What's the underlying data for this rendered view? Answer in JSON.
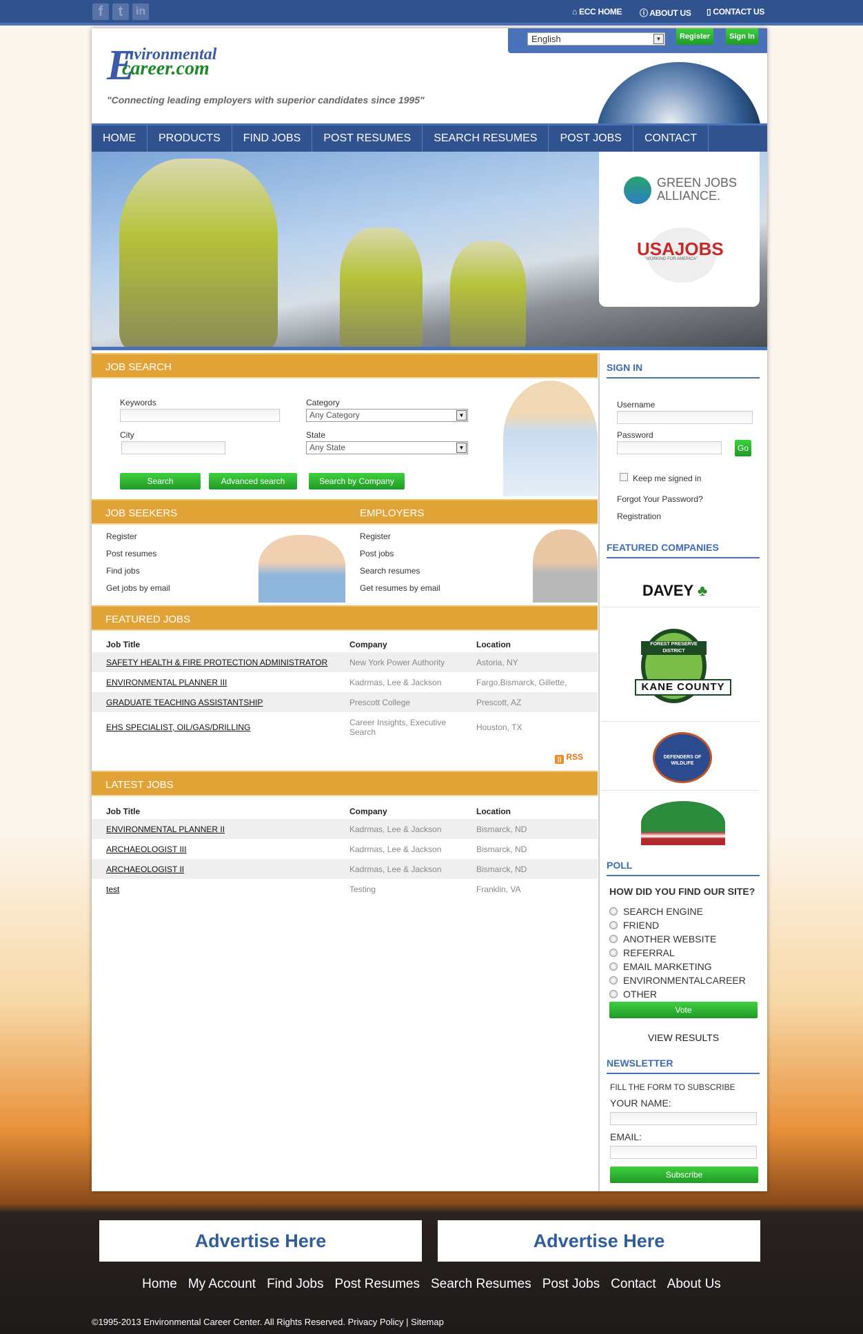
{
  "topbar": {
    "social": [
      "f",
      "t",
      "in"
    ],
    "links": [
      "ECC HOME",
      "ABOUT US",
      "CONTACT US"
    ]
  },
  "header": {
    "language": "English",
    "register": "Register",
    "signin": "Sign In",
    "logo_line1": "nvironmental",
    "logo_line2": "career.com",
    "logo_letter": "E",
    "tagline": "\"Connecting leading employers with superior candidates since 1995\""
  },
  "nav": [
    "HOME",
    "PRODUCTS",
    "FIND JOBS",
    "POST RESUMES",
    "SEARCH RESUMES",
    "POST JOBS",
    "CONTACT"
  ],
  "partners": {
    "gja1": "GREEN JOBS",
    "gja2": "ALLIANCE.",
    "usa": "USAJOBS",
    "usa_sub": "\"WORKING FOR AMERICA\""
  },
  "job_search": {
    "title": "JOB SEARCH",
    "keywords": "Keywords",
    "category": "Category",
    "category_value": "Any Category",
    "city": "City",
    "state": "State",
    "state_value": "Any State",
    "search": "Search",
    "advanced": "Advanced search",
    "by_company": "Search by Company"
  },
  "seekers": {
    "title": "JOB SEEKERS",
    "links": [
      "Register",
      "Post resumes",
      "Find jobs",
      "Get jobs by email"
    ]
  },
  "employers": {
    "title": "EMPLOYERS",
    "links": [
      "Register",
      "Post jobs",
      "Search resumes",
      "Get resumes by email"
    ]
  },
  "featured_jobs": {
    "title": "FEATURED JOBS",
    "headers": [
      "Job Title",
      "Company",
      "Location"
    ],
    "rows": [
      [
        "SAFETY HEALTH & FIRE PROTECTION ADMINISTRATOR",
        "New York Power Authority",
        "Astoria, NY"
      ],
      [
        "ENVIRONMENTAL PLANNER III",
        "Kadrmas, Lee & Jackson",
        "Fargo,Bismarck, Gillette,"
      ],
      [
        "GRADUATE TEACHING ASSISTANTSHIP",
        "Prescott College",
        "Prescott, AZ"
      ],
      [
        "EHS SPECIALIST, OIL/GAS/DRILLING",
        "Career Insights, Executive Search",
        "Houston, TX"
      ]
    ],
    "rss": "RSS"
  },
  "latest_jobs": {
    "title": "LATEST JOBS",
    "headers": [
      "Job Title",
      "Company",
      "Location"
    ],
    "rows": [
      [
        "ENVIRONMENTAL PLANNER II",
        "Kadrmas, Lee & Jackson",
        "Bismarck, ND"
      ],
      [
        "ARCHAEOLOGIST III",
        "Kadrmas, Lee & Jackson",
        "Bismarck, ND"
      ],
      [
        "ARCHAEOLOGIST II",
        "Kadrmas, Lee & Jackson",
        "Bismarck, ND"
      ],
      [
        "test",
        "Testing",
        "Franklin, VA"
      ]
    ]
  },
  "signin": {
    "title": "SIGN IN",
    "username": "Username",
    "password": "Password",
    "go": "Go",
    "keep": "Keep me signed in",
    "forgot": "Forgot Your Password?",
    "registration": "Registration"
  },
  "featured_companies": {
    "title": "FEATURED COMPANIES",
    "davey": "DAVEY",
    "kane1": "FOREST PRESERVE DISTRICT",
    "kane2": "KANE COUNTY",
    "defenders": "DEFENDERS OF WILDLIFE"
  },
  "poll": {
    "title": "POLL",
    "question": "HOW DID YOU FIND OUR SITE?",
    "options": [
      "SEARCH ENGINE",
      "FRIEND",
      "ANOTHER WEBSITE",
      "REFERRAL",
      "EMAIL MARKETING",
      "ENVIRONMENTALCAREER",
      "OTHER"
    ],
    "vote": "Vote",
    "results": "VIEW RESULTS"
  },
  "newsletter": {
    "title": "NEWSLETTER",
    "intro": "FILL THE FORM TO SUBSCRIBE",
    "name": "YOUR NAME:",
    "email": "EMAIL:",
    "subscribe": "Subscribe"
  },
  "footer": {
    "ads": [
      "Advertise Here",
      "Advertise Here"
    ],
    "links": [
      "Home",
      "My Account",
      "Find Jobs",
      "Post Resumes",
      "Search Resumes",
      "Post Jobs",
      "Contact",
      "About Us"
    ],
    "copyright": "©1995-2013 Environmental Career Center. All Rights Reserved.",
    "privacy": "Privacy Policy",
    "sitemap": "Sitemap"
  },
  "colors": {
    "blue": "#30528f",
    "orange": "#e2a336",
    "green": "#2fb52f",
    "link_blue": "#3d6bb8"
  }
}
